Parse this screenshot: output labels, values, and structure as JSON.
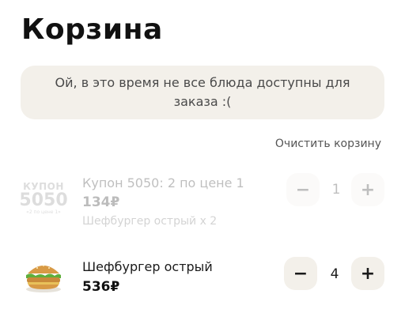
{
  "page": {
    "title": "Корзина"
  },
  "notice": {
    "text": "Ой, в это время не все блюда доступны для заказа :("
  },
  "clear_cart_label": "Очистить корзину",
  "items": [
    {
      "name": "Купон 5050: 2 по цене 1",
      "price": "134₽",
      "details": "Шефбургер острый x 2",
      "quantity": "1",
      "available": false,
      "image": {
        "line1": "КУПОН",
        "line2": "5050",
        "line3": "«2 по цене 1»"
      }
    },
    {
      "name": "Шефбургер острый",
      "price": "536₽",
      "quantity": "4",
      "available": true,
      "image_icon": "burger-icon"
    }
  ],
  "stepper": {
    "minus": "−",
    "plus": "+"
  },
  "colors": {
    "notice_bg": "#f3f0ea",
    "button_bg": "#f3f0ea",
    "text": "#1a1a1a"
  }
}
